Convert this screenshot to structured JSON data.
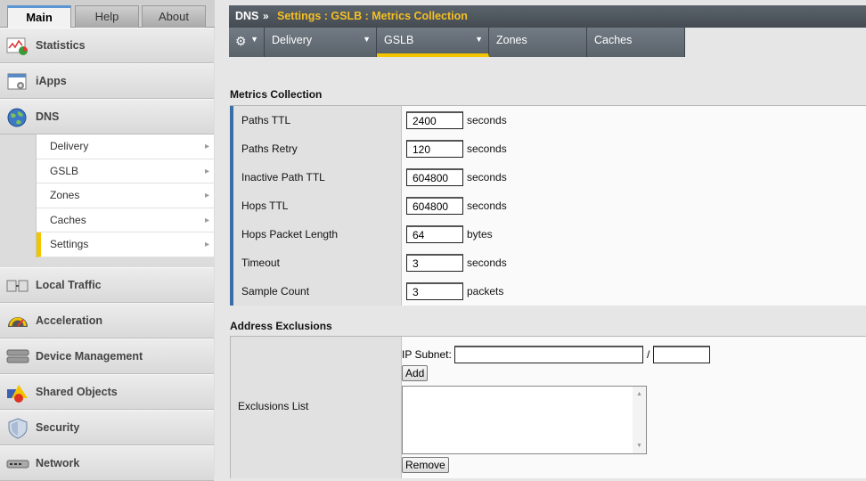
{
  "left_tabs": [
    "Main",
    "Help",
    "About"
  ],
  "nav": {
    "statistics": "Statistics",
    "iapps": "iApps",
    "dns": "DNS",
    "dns_sub": [
      "Delivery",
      "GSLB",
      "Zones",
      "Caches",
      "Settings"
    ],
    "local_traffic": "Local Traffic",
    "acceleration": "Acceleration",
    "device_management": "Device Management",
    "shared_objects": "Shared Objects",
    "security": "Security",
    "network": "Network"
  },
  "breadcrumb": {
    "root": "DNS",
    "separator": "»",
    "path": "Settings : GSLB : Metrics Collection"
  },
  "top_tabs": [
    "Delivery",
    "GSLB",
    "Zones",
    "Caches"
  ],
  "active_top_tab": "GSLB",
  "metrics": {
    "title": "Metrics Collection",
    "rows": [
      {
        "label": "Paths TTL",
        "value": "2400",
        "unit": "seconds"
      },
      {
        "label": "Paths Retry",
        "value": "120",
        "unit": "seconds"
      },
      {
        "label": "Inactive Path TTL",
        "value": "604800",
        "unit": "seconds"
      },
      {
        "label": "Hops TTL",
        "value": "604800",
        "unit": "seconds"
      },
      {
        "label": "Hops Packet Length",
        "value": "64",
        "unit": "bytes"
      },
      {
        "label": "Timeout",
        "value": "3",
        "unit": "seconds"
      },
      {
        "label": "Sample Count",
        "value": "3",
        "unit": "packets"
      }
    ]
  },
  "exclusions": {
    "title": "Address Exclusions",
    "list_label": "Exclusions List",
    "ip_subnet_label": "IP Subnet:",
    "slash": "/",
    "ip_value": "",
    "mask_value": "",
    "add": "Add",
    "remove": "Remove"
  },
  "colors": {
    "accent_yellow": "#f3c400",
    "row_marker_blue": "#3a6ea6",
    "header_gray": "#4f575f"
  }
}
